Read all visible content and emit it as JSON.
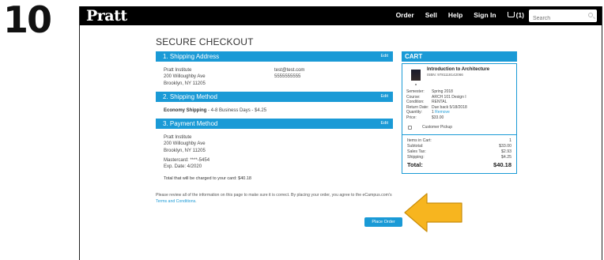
{
  "step_number": "10",
  "header": {
    "logo": "Pratt",
    "nav": [
      "Order",
      "Sell",
      "Help",
      "Sign In"
    ],
    "cart_count": "(1)",
    "search_placeholder": "Search"
  },
  "page_title": "SECURE CHECKOUT",
  "shipping_address": {
    "heading": "1. Shipping Address",
    "edit": "Edit",
    "name": "Pratt Institute",
    "street": "200 Willoughby Ave",
    "city": "Brooklyn, NY 11205",
    "email": "test@test.com",
    "phone": "5555555555"
  },
  "shipping_method": {
    "heading": "2. Shipping Method",
    "edit": "Edit",
    "method_name": "Economy Shipping",
    "method_detail": " - 4-8 Business Days - $4.25"
  },
  "payment_method": {
    "heading": "3. Payment Method",
    "edit": "Edit",
    "name": "Pratt Institute",
    "street": "200 Willoughby Ave",
    "city": "Brooklyn, NY 11205",
    "card": "Mastercard: ****-5454",
    "exp": "Exp. Date: 4/2020"
  },
  "total_charged": "Total that will be charged to your card: $40.18",
  "review": {
    "text": "Please review all of the information on this page to make sure it is correct. By placing your order, you agree to the eCampus.com's ",
    "link": "Terms and Conditions",
    "end": "."
  },
  "place_order": "Place Order",
  "cart": {
    "heading": "CART",
    "item": {
      "title": "Introduction to Architecture",
      "isbn": "ISBN: 9781118142066",
      "details": [
        {
          "k": "Semester:",
          "v": "Spring 2018"
        },
        {
          "k": "Course:",
          "v": "ARCH 101 Design I"
        },
        {
          "k": "Condition:",
          "v": "RENTAL"
        },
        {
          "k": "Return Date:",
          "v": "Due back 5/18/2018"
        },
        {
          "k": "Quantity:",
          "v": "1"
        },
        {
          "k": "Price:",
          "v": "$33.00"
        }
      ],
      "remove": "Remove",
      "pickup": "Customer Pickup"
    },
    "totals": {
      "items_label": "Items in Cart:",
      "items": "1",
      "subtotal_label": "Subtotal:",
      "subtotal": "$33.00",
      "tax_label": "Sales Tax:",
      "tax": "$2.93",
      "shipping_label": "Shipping:",
      "shipping": "$4.25",
      "total_label": "Total:",
      "total": "$40.18"
    }
  },
  "colors": {
    "accent": "#1a9ad6",
    "arrow": "#f7b51f",
    "topbar": "#000000"
  }
}
